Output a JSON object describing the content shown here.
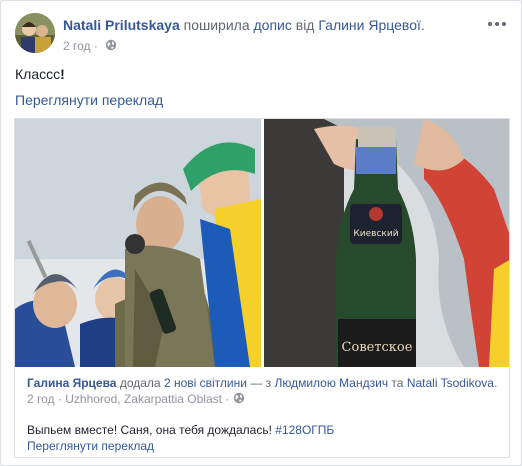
{
  "post": {
    "author": "Natali Prilutskaya",
    "action": "поширила",
    "object": "допис",
    "preposition": "від",
    "original_author": "Галини Ярцевої",
    "period": ".",
    "time": "2 год",
    "meta_sep": "·",
    "privacy_icon": "globe-icon",
    "text": "Классс",
    "text_emphasis": "!",
    "translate_label": "Переглянути переклад"
  },
  "shared": {
    "author": "Галина Ярцева",
    "action": "додала",
    "photos_link": "2 нові світлини",
    "with": "— з",
    "tagged_1": "Людмилою Мандзич",
    "and": "та",
    "tagged_2": "Natali Tsodikova",
    "period": ".",
    "time": "2 год",
    "meta_sep": "·",
    "location": "Uzhhorod, Zakarpattia Oblast",
    "privacy_icon": "globe-icon",
    "text": "Выпьем вместе! Саня, она тебя дождалась!",
    "hashtag": "#128ОГПБ",
    "translate_label": "Переглянути переклад"
  },
  "photos": {
    "bottle_label_1": "Советское",
    "bottle_label_2": "Киевский"
  },
  "colors": {
    "link": "#365899",
    "muted": "#90949c",
    "border": "#dddfe2",
    "flag_blue": "#1c5bb7",
    "flag_yellow": "#f5d02a"
  }
}
